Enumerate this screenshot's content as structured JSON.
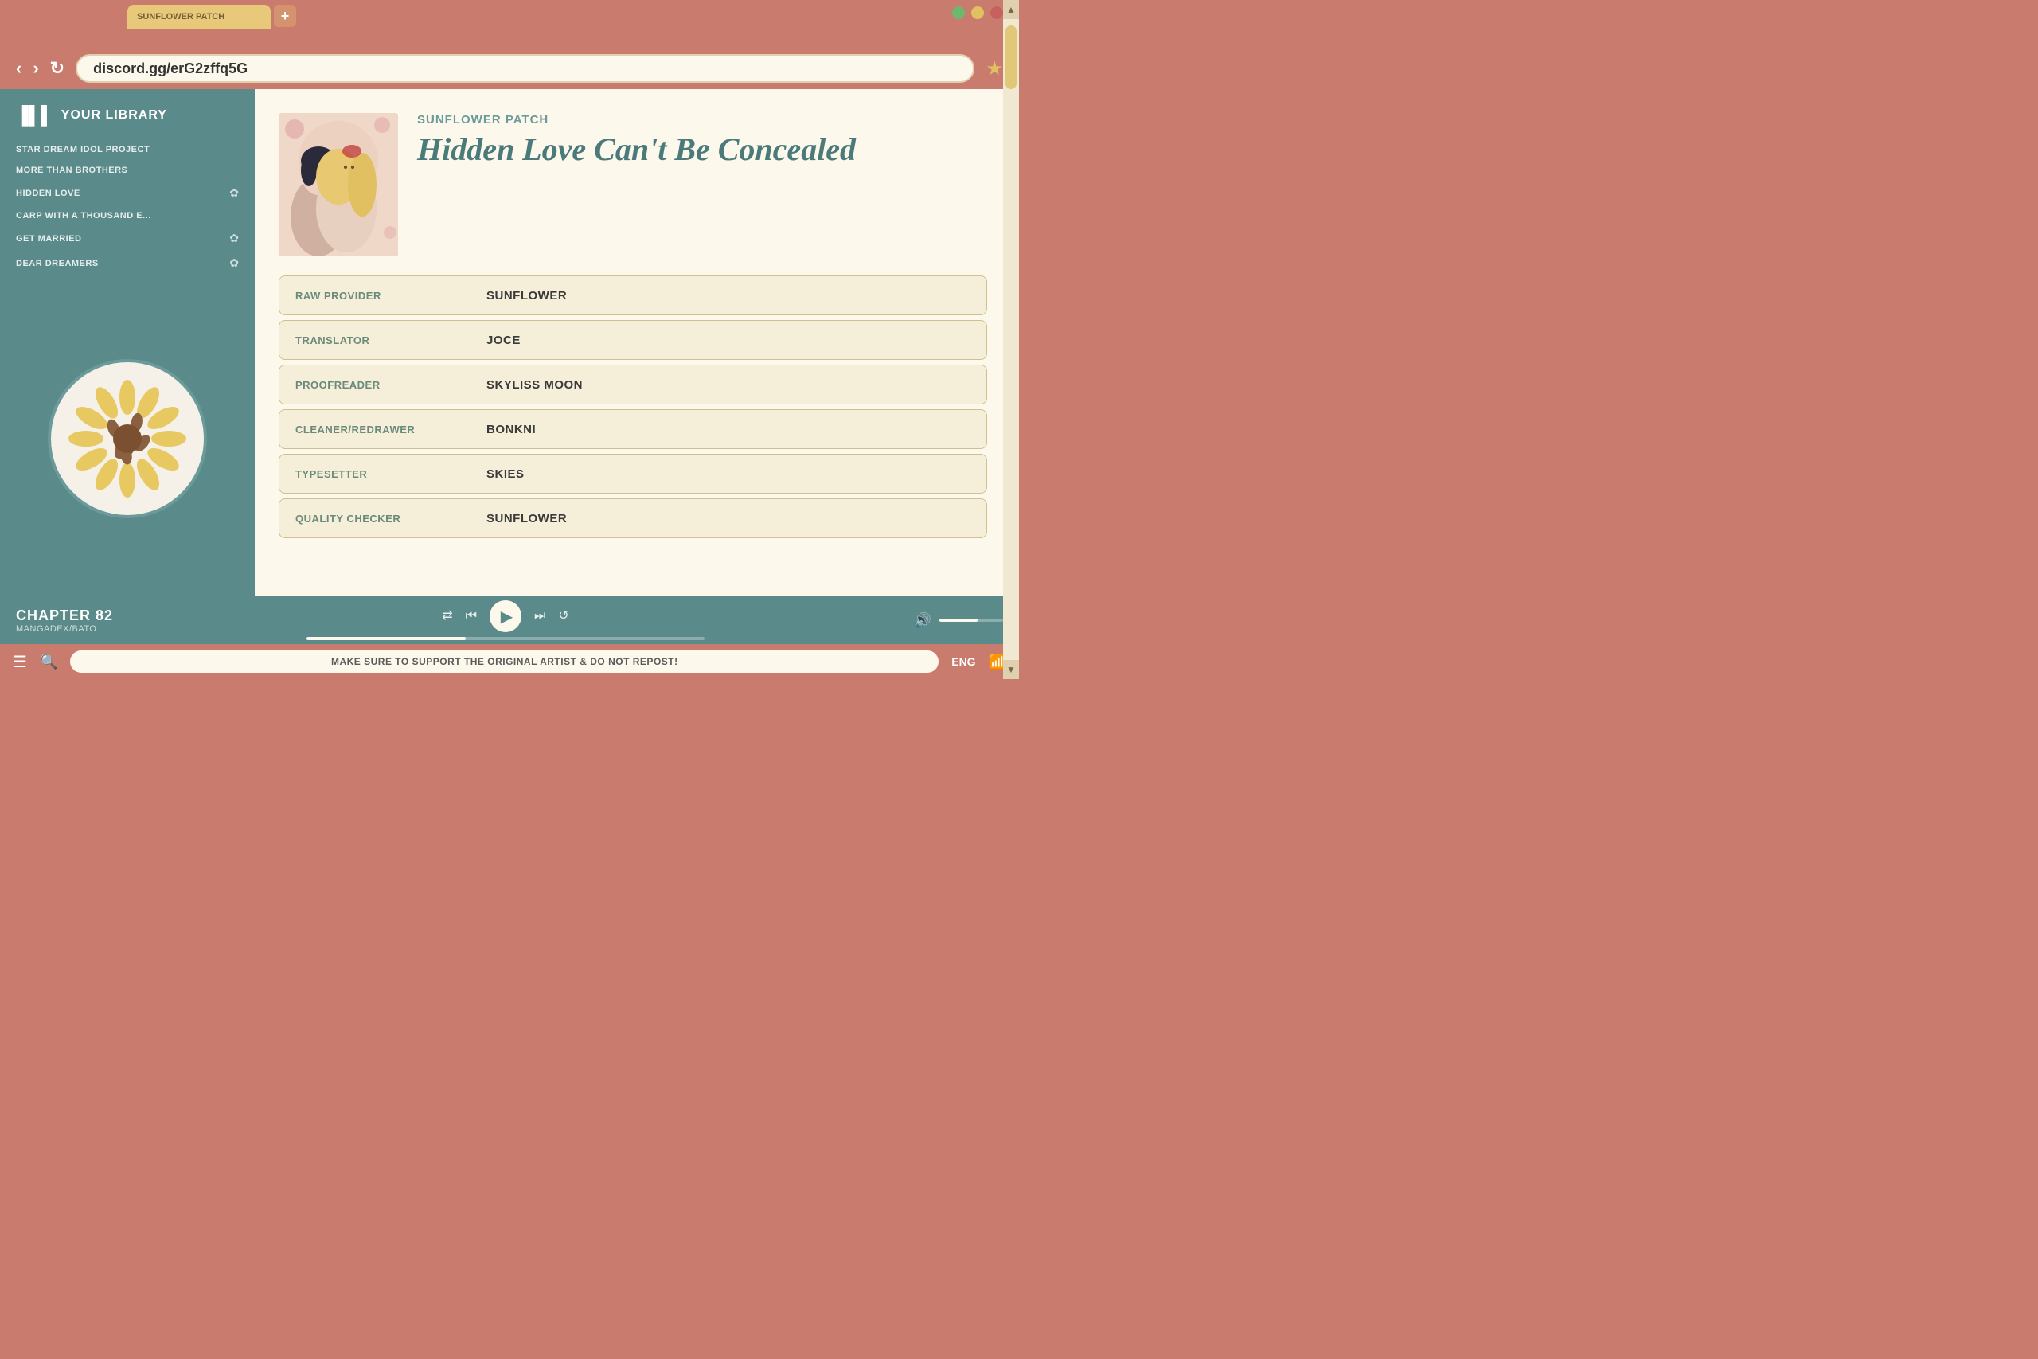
{
  "browser": {
    "tab_label": "SUNFLOWER PATCH",
    "tab_add": "+",
    "url": "discord.gg/erG2zffq5G",
    "win_btn_colors": [
      "green",
      "yellow",
      "red"
    ]
  },
  "nav": {
    "back": "‹",
    "forward": "›",
    "reload": "↻",
    "star": "★"
  },
  "sidebar": {
    "title": "YOUR LIBRARY",
    "items": [
      {
        "label": "STAR DREAM IDOL PROJECT",
        "has_icon": false
      },
      {
        "label": "MORE THAN BROTHERS",
        "has_icon": false
      },
      {
        "label": "HIDDEN LOVE",
        "has_icon": true
      },
      {
        "label": "CARP WITH A THOUSAND E...",
        "has_icon": false
      },
      {
        "label": "GET MARRIED",
        "has_icon": true
      },
      {
        "label": "DEAR DREAMERS",
        "has_icon": true
      }
    ]
  },
  "manga": {
    "publisher": "SUNFLOWER PATCH",
    "title": "Hidden Love Can't Be Concealed",
    "credits": [
      {
        "role": "RAW PROVIDER",
        "name": "SUNFLOWER"
      },
      {
        "role": "TRANSLATOR",
        "name": "JOCE"
      },
      {
        "role": "PROOFREADER",
        "name": "SKYLISS MOON"
      },
      {
        "role": "CLEANER/REDRAWER",
        "name": "BONKNI"
      },
      {
        "role": "TYPESETTER",
        "name": "SKIES"
      },
      {
        "role": "QUALITY CHECKER",
        "name": "SUNFLOWER"
      }
    ]
  },
  "player": {
    "chapter": "CHAPTER 82",
    "source": "MANGADEX/BATO"
  },
  "status_bar": {
    "message": "MAKE SURE TO SUPPORT THE ORIGINAL ARTIST & DO NOT REPOST!",
    "lang": "ENG"
  },
  "scrollbar": {
    "up_arrow": "▲",
    "down_arrow": "▼"
  }
}
